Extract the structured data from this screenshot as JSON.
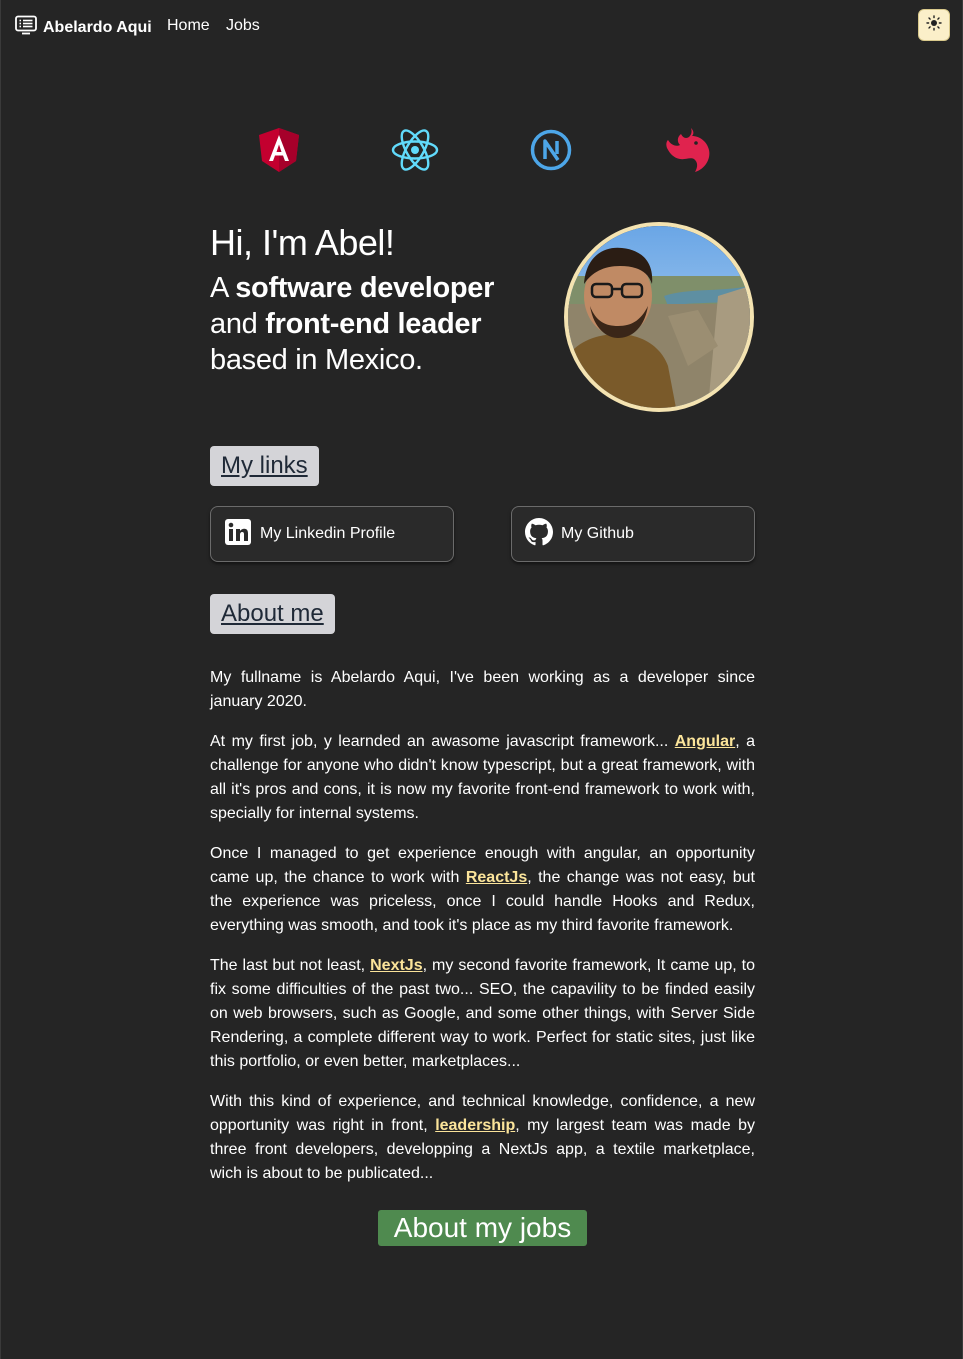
{
  "nav": {
    "brand": "Abelardo Aqui",
    "links": [
      "Home",
      "Jobs"
    ],
    "brand_icon": "terminal-list-icon",
    "theme_icon": "sun-icon"
  },
  "tech_icons": [
    "angular-icon",
    "react-icon",
    "nextjs-icon",
    "nestjs-icon"
  ],
  "hero": {
    "greeting": "Hi, I'm Abel!",
    "desc_a": "A ",
    "desc_b": "software developer",
    "desc_c": " and ",
    "desc_d": "front-end leader",
    "desc_e": " based in Mexico."
  },
  "links_section": {
    "title": "My links",
    "cards": [
      {
        "label": "My Linkedin Profile",
        "icon": "linkedin-icon"
      },
      {
        "label": "My Github",
        "icon": "github-icon"
      }
    ]
  },
  "about": {
    "title": "About me",
    "p1": "My fullname is Abelardo Aqui, I've been working as a developer since january 2020.",
    "p2_a": "At my first job, y learnded an awasome javascript framework... ",
    "p2_link": "Angular",
    "p2_b": ", a challenge for anyone who didn't know typescript, but a great framework, with all it's pros and cons, it is now my favorite front-end framework to work with, specially for internal systems.",
    "p3_a": "Once I managed to get experience enough with angular, an opportunity came up, the chance to work with ",
    "p3_link": "ReactJs",
    "p3_b": ", the change was not easy, but the experience was priceless, once I could handle Hooks and Redux, everything was smooth, and took it's place as my third favorite framework.",
    "p4_a": "The last but not least, ",
    "p4_link": "NextJs",
    "p4_b": ", my second favorite framework, It came up, to fix some difficulties of the past two... SEO, the capavility to be finded easily on web browsers, such as Google, and some other things, with Server Side Rendering, a complete different way to work. Perfect for static sites, just like this portfolio, or even better, marketplaces...",
    "p5_a": "With this kind of experience, and technical knowledge, confidence, a new opportunity was right in front, ",
    "p5_link": "leadership",
    "p5_b": ", my largest team was made by three front developers, developping a NextJs app, a textile marketplace, wich is about to be publicated..."
  },
  "jobs_button": "About my jobs",
  "colors": {
    "background": "#252525",
    "accent_link": "#fbe49a",
    "jobs_button": "#4f8a4f",
    "section_button": "#d4d4d8",
    "avatar_border": "#f4e3b1"
  }
}
